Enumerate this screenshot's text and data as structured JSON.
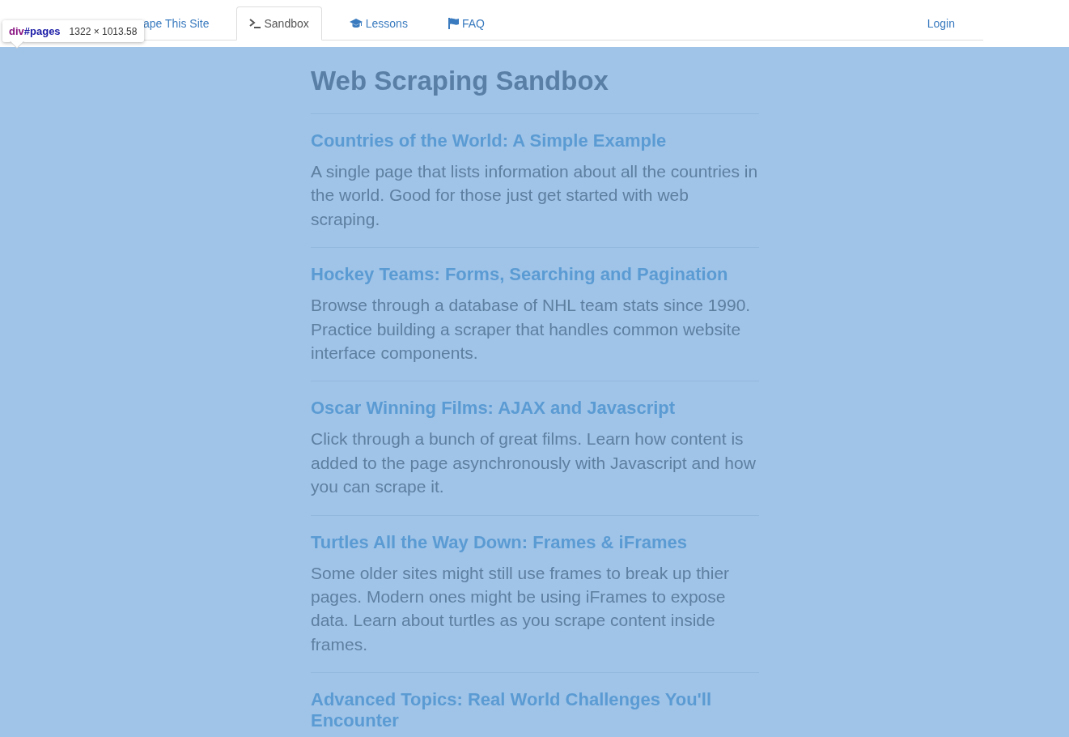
{
  "inspector_tooltip": {
    "tag": "div",
    "id": "#pages",
    "size": "1322 × 1013.58"
  },
  "nav": {
    "tabs": [
      {
        "label": "ape This Site",
        "kind": "home",
        "selected": false
      },
      {
        "label": "Sandbox",
        "kind": "sandbox",
        "selected": true
      },
      {
        "label": "Lessons",
        "kind": "lessons",
        "selected": false
      },
      {
        "label": "FAQ",
        "kind": "faq",
        "selected": false
      }
    ],
    "login": "Login"
  },
  "page": {
    "title": "Web Scraping Sandbox",
    "sections": [
      {
        "title": "Countries of the World: A Simple Example",
        "description": "A single page that lists information about all the countries in the world. Good for those just get started with web scraping."
      },
      {
        "title": "Hockey Teams: Forms, Searching and Pagination",
        "description": "Browse through a database of NHL team stats since 1990. Practice building a scraper that handles common website interface components."
      },
      {
        "title": "Oscar Winning Films: AJAX and Javascript",
        "description": "Click through a bunch of great films. Learn how content is added to the page asynchronously with Javascript and how you can scrape it."
      },
      {
        "title": "Turtles All the Way Down: Frames & iFrames",
        "description": "Some older sites might still use frames to break up thier pages. Modern ones might be using iFrames to expose data. Learn about turtles as you scrape content inside frames."
      },
      {
        "title": "Advanced Topics: Real World Challenges You'll Encounter"
      }
    ]
  }
}
